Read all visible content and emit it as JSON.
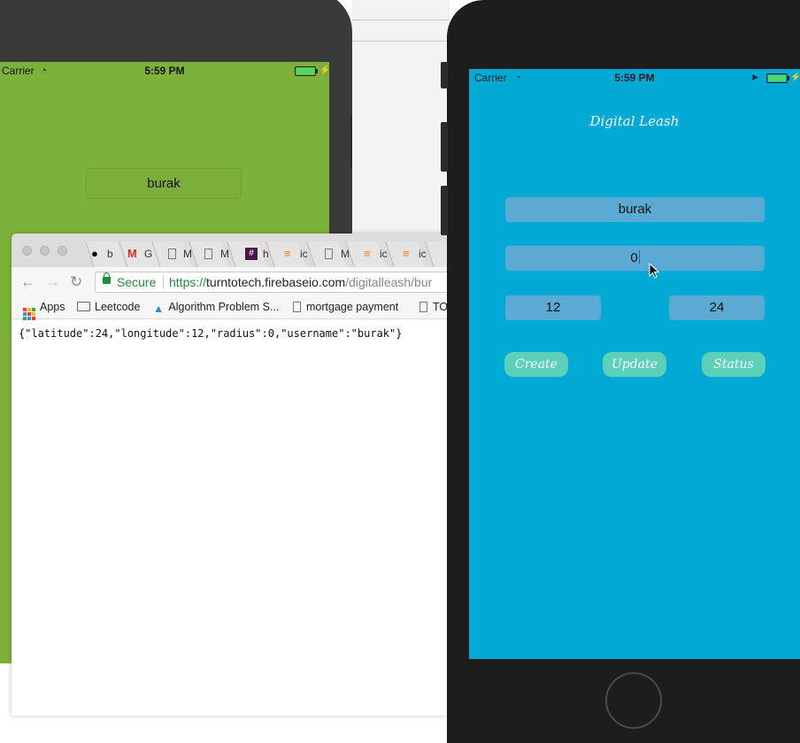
{
  "left_phone": {
    "status_bar": {
      "carrier": "Carrier",
      "time": "5:59 PM"
    },
    "name_field_value": "burak",
    "background_color": "#7db23a"
  },
  "browser": {
    "tabs": [
      {
        "icon": "github-icon",
        "text": "b"
      },
      {
        "icon": "gmail-icon",
        "text": "G"
      },
      {
        "icon": "doc-icon",
        "text": "M"
      },
      {
        "icon": "doc-icon",
        "text": "M"
      },
      {
        "icon": "slack-hash-icon",
        "text": "h"
      },
      {
        "icon": "stackoverflow-icon",
        "text": "ic"
      },
      {
        "icon": "doc-icon",
        "text": "M"
      },
      {
        "icon": "stackoverflow-icon",
        "text": "ic"
      },
      {
        "icon": "stackoverflow-icon",
        "text": "ic"
      }
    ],
    "address": {
      "secure_label": "Secure",
      "url_scheme": "https://",
      "url_host": "turntotech.firebaseio.com",
      "url_path": "/digitalleash/bur"
    },
    "bookmarks": {
      "apps": "Apps",
      "leetcode": "Leetcode",
      "algorithm": "Algorithm Problem S...",
      "mortgage": "mortgage payment",
      "to": "TO"
    },
    "content": "{\"latitude\":24,\"longitude\":12,\"radius\":0,\"username\":\"burak\"}"
  },
  "right_phone": {
    "status_bar": {
      "carrier": "Carrier",
      "time": "5:59 PM"
    },
    "app_title": "Digital Leash",
    "username_field": "burak",
    "radius_field": "0",
    "longitude_field": "12",
    "latitude_field": "24",
    "buttons": {
      "create": "Create",
      "update": "Update",
      "status": "Status"
    },
    "colors": {
      "screen": "#00aad4",
      "field": "#5aaad3",
      "button": "#5cd0b8"
    }
  }
}
